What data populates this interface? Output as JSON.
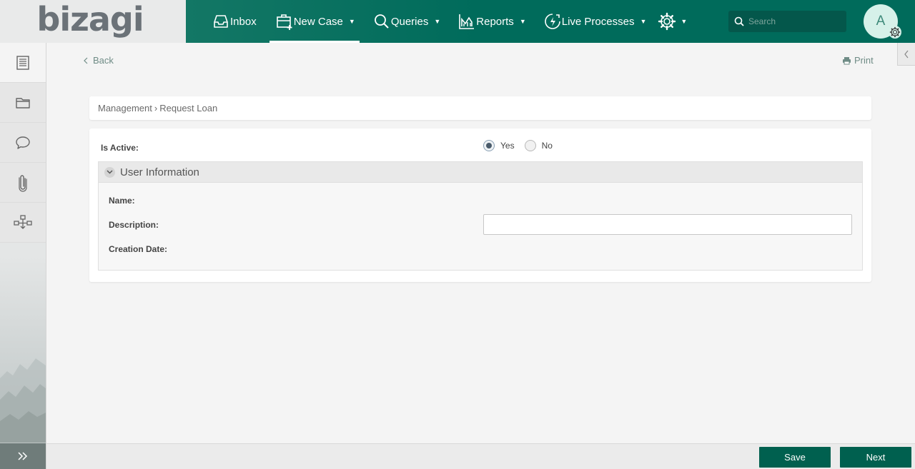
{
  "brand": {
    "logo_text": "bizagi"
  },
  "nav": {
    "items": [
      {
        "label": "Inbox",
        "icon": "inbox-icon",
        "has_caret": false
      },
      {
        "label": "New Case",
        "icon": "new-case-icon",
        "has_caret": true,
        "active": true
      },
      {
        "label": "Queries",
        "icon": "search-icon",
        "has_caret": true
      },
      {
        "label": "Reports",
        "icon": "reports-icon",
        "has_caret": true
      },
      {
        "label": "Live Processes",
        "icon": "live-processes-icon",
        "has_caret": true
      }
    ],
    "settings_icon": "gear-icon"
  },
  "search": {
    "placeholder": "Search"
  },
  "user": {
    "initial": "A"
  },
  "rail": {
    "items": [
      "case-list-icon",
      "folder-icon",
      "comments-icon",
      "attachments-icon",
      "process-map-icon"
    ],
    "expand_icon": "double-chevron-right-icon"
  },
  "page": {
    "back_label": "Back",
    "print_label": "Print",
    "breadcrumb": [
      "Management",
      "Request Loan"
    ],
    "breadcrumb_sep": "›"
  },
  "form": {
    "is_active_label": "Is Active:",
    "is_active_options": [
      "Yes",
      "No"
    ],
    "is_active_value": "Yes",
    "group_title": "User Information",
    "name_label": "Name:",
    "description_label": "Description:",
    "description_value": "",
    "creation_date_label": "Creation Date:"
  },
  "footer": {
    "save_label": "Save",
    "next_label": "Next"
  },
  "colors": {
    "primary": "#006b5b",
    "button": "#00604f",
    "link": "#6f8c86"
  }
}
